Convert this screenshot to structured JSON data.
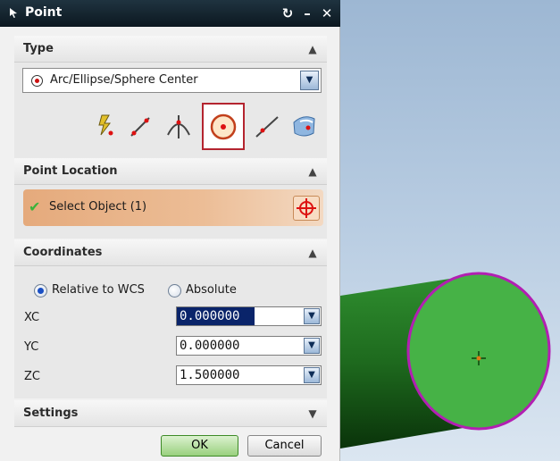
{
  "window": {
    "title": "Point"
  },
  "type_section": {
    "header": "Type",
    "dropdown_value": "Arc/Ellipse/Sphere Center",
    "tools": [
      "inferred-point-icon",
      "line-point-icon",
      "intersection-point-icon",
      "arc-center-icon",
      "point-on-curve-icon",
      "surface-point-icon"
    ],
    "selected_tool": "arc-center-icon"
  },
  "point_location": {
    "header": "Point Location",
    "select_label": "Select Object (1)"
  },
  "coordinates": {
    "header": "Coordinates",
    "reference_options": [
      "Relative to WCS",
      "Absolute"
    ],
    "selected_reference": "Relative to WCS",
    "fields": [
      {
        "label": "XC",
        "value": "0.000000"
      },
      {
        "label": "YC",
        "value": "0.000000"
      },
      {
        "label": "ZC",
        "value": "1.500000"
      }
    ]
  },
  "settings": {
    "header": "Settings"
  },
  "buttons": {
    "ok": "OK",
    "cancel": "Cancel"
  },
  "colors": {
    "title_bar": "#152733",
    "selection_bar": "#e5aa7c",
    "cylinder_face": "#46b246",
    "face_edge": "#b21fb2",
    "ok_button": "#99d07e"
  }
}
